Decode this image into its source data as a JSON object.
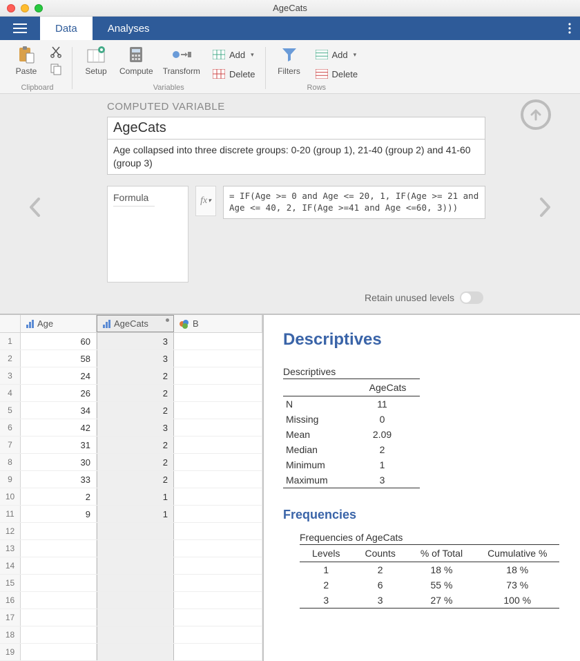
{
  "window": {
    "title": "AgeCats"
  },
  "tabs": {
    "data": "Data",
    "analyses": "Analyses"
  },
  "ribbon": {
    "paste": "Paste",
    "clipboard_group": "Clipboard",
    "setup": "Setup",
    "compute": "Compute",
    "transform": "Transform",
    "add": "Add",
    "delete": "Delete",
    "variables_group": "Variables",
    "filters": "Filters",
    "rows_group": "Rows"
  },
  "panel": {
    "heading": "COMPUTED VARIABLE",
    "name": "AgeCats",
    "description": "Age collapsed into three discrete groups: 0-20 (group 1), 21-40 (group 2) and 41-60 (group 3)",
    "formula_label": "Formula",
    "fx": "fx",
    "formula": "= IF(Age >= 0 and Age <= 20, 1, IF(Age >= 21 and Age <= 40, 2, IF(Age >=41 and Age <=60, 3)))",
    "retain_label": "Retain unused levels"
  },
  "columns": {
    "age": "Age",
    "agecats": "AgeCats",
    "b": "B"
  },
  "rows": [
    {
      "n": "1",
      "age": "60",
      "cats": "3"
    },
    {
      "n": "2",
      "age": "58",
      "cats": "3"
    },
    {
      "n": "3",
      "age": "24",
      "cats": "2"
    },
    {
      "n": "4",
      "age": "26",
      "cats": "2"
    },
    {
      "n": "5",
      "age": "34",
      "cats": "2"
    },
    {
      "n": "6",
      "age": "42",
      "cats": "3"
    },
    {
      "n": "7",
      "age": "31",
      "cats": "2"
    },
    {
      "n": "8",
      "age": "30",
      "cats": "2"
    },
    {
      "n": "9",
      "age": "33",
      "cats": "2"
    },
    {
      "n": "10",
      "age": "2",
      "cats": "1"
    },
    {
      "n": "11",
      "age": "9",
      "cats": "1"
    },
    {
      "n": "12",
      "age": "",
      "cats": ""
    },
    {
      "n": "13",
      "age": "",
      "cats": ""
    },
    {
      "n": "14",
      "age": "",
      "cats": ""
    },
    {
      "n": "15",
      "age": "",
      "cats": ""
    },
    {
      "n": "16",
      "age": "",
      "cats": ""
    },
    {
      "n": "17",
      "age": "",
      "cats": ""
    },
    {
      "n": "18",
      "age": "",
      "cats": ""
    },
    {
      "n": "19",
      "age": "",
      "cats": ""
    }
  ],
  "results": {
    "title": "Descriptives",
    "desc_caption": "Descriptives",
    "desc_colhead": "AgeCats",
    "stats": [
      {
        "label": "N",
        "value": "11"
      },
      {
        "label": "Missing",
        "value": "0"
      },
      {
        "label": "Mean",
        "value": "2.09"
      },
      {
        "label": "Median",
        "value": "2"
      },
      {
        "label": "Minimum",
        "value": "1"
      },
      {
        "label": "Maximum",
        "value": "3"
      }
    ],
    "freq_title": "Frequencies",
    "freq_caption": "Frequencies of AgeCats",
    "freq_headers": {
      "levels": "Levels",
      "counts": "Counts",
      "pct": "% of Total",
      "cum": "Cumulative %"
    },
    "freq_rows": [
      {
        "level": "1",
        "count": "2",
        "pct": "18 %",
        "cum": "18 %"
      },
      {
        "level": "2",
        "count": "6",
        "pct": "55 %",
        "cum": "73 %"
      },
      {
        "level": "3",
        "count": "3",
        "pct": "27 %",
        "cum": "100 %"
      }
    ]
  }
}
